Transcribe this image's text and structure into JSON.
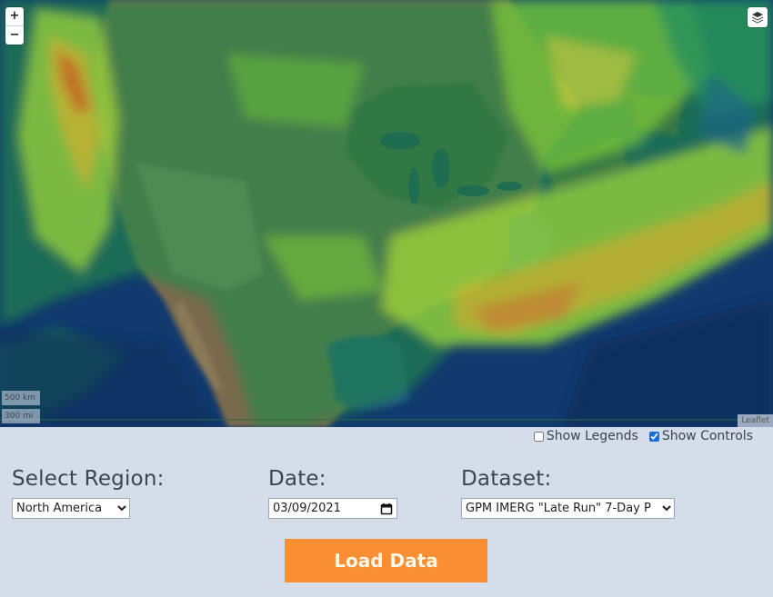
{
  "map": {
    "zoom_in_label": "+",
    "zoom_out_label": "−",
    "layers_icon": "layers-icon",
    "scale_km": "500 km",
    "scale_mi": "300 mi",
    "attribution": "Leaflet",
    "colors": {
      "ocean": "#123a6e",
      "land": "#7a6a4e",
      "precip_low": "#1f8a4a",
      "precip_mid": "#5fbf3a",
      "precip_high": "#c9d62a",
      "precip_max": "#e07a1e"
    }
  },
  "toggles": {
    "show_legends": {
      "label": "Show Legends",
      "checked": false
    },
    "show_controls": {
      "label": "Show Controls",
      "checked": true
    }
  },
  "form": {
    "region": {
      "label": "Select Region:",
      "value": "North America"
    },
    "date": {
      "label": "Date:",
      "value": "03/09/2021"
    },
    "dataset": {
      "label": "Dataset:",
      "value": "GPM IMERG \"Late Run\" 7-Day P"
    },
    "load_button": "Load Data",
    "accent": "#fa8e32"
  }
}
